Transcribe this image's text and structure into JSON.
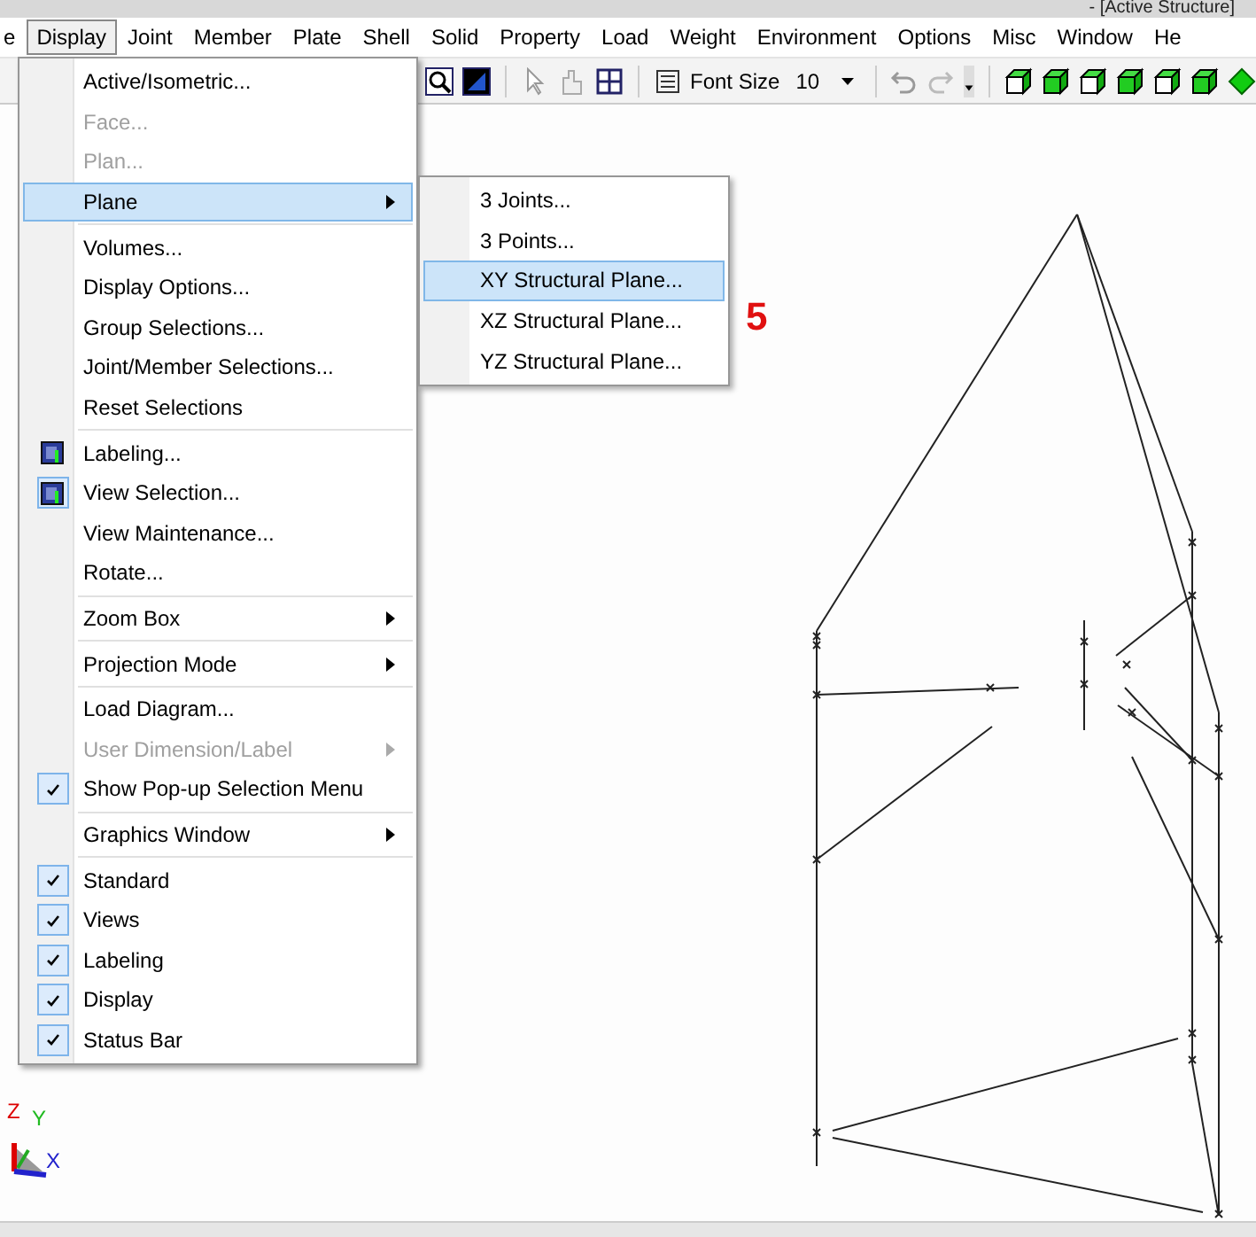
{
  "window": {
    "title": "- [Active Structure]"
  },
  "menubar": [
    {
      "label": "e",
      "selected": false
    },
    {
      "label": "Display",
      "selected": true
    },
    {
      "label": "Joint",
      "selected": false
    },
    {
      "label": "Member",
      "selected": false
    },
    {
      "label": "Plate",
      "selected": false
    },
    {
      "label": "Shell",
      "selected": false
    },
    {
      "label": "Solid",
      "selected": false
    },
    {
      "label": "Property",
      "selected": false
    },
    {
      "label": "Load",
      "selected": false
    },
    {
      "label": "Weight",
      "selected": false
    },
    {
      "label": "Environment",
      "selected": false
    },
    {
      "label": "Options",
      "selected": false
    },
    {
      "label": "Misc",
      "selected": false
    },
    {
      "label": "Window",
      "selected": false
    },
    {
      "label": "He",
      "selected": false
    }
  ],
  "toolbar": {
    "font_size_label": "Font Size",
    "font_size_value": "10"
  },
  "menu": [
    {
      "kind": "item",
      "label": "Active/Isometric...",
      "disabled": false,
      "selected": false
    },
    {
      "kind": "item",
      "label": "Face...",
      "disabled": true,
      "selected": false
    },
    {
      "kind": "item",
      "label": "Plan...",
      "disabled": true,
      "selected": false
    },
    {
      "kind": "submenu",
      "label": "Plane",
      "disabled": false,
      "selected": true
    },
    {
      "kind": "separator"
    },
    {
      "kind": "item",
      "label": "Volumes...",
      "disabled": false,
      "selected": false
    },
    {
      "kind": "item",
      "label": "Display Options...",
      "disabled": false,
      "selected": false
    },
    {
      "kind": "item",
      "label": "Group Selections...",
      "disabled": false,
      "selected": false
    },
    {
      "kind": "item",
      "label": "Joint/Member Selections...",
      "disabled": false,
      "selected": false
    },
    {
      "kind": "item",
      "label": "Reset Selections",
      "disabled": false,
      "selected": false
    },
    {
      "kind": "separator"
    },
    {
      "kind": "tool",
      "label": "Labeling...",
      "disabled": false,
      "selected": false,
      "checked": false
    },
    {
      "kind": "tool",
      "label": "View Selection...",
      "disabled": false,
      "selected": false,
      "checked": true
    },
    {
      "kind": "item",
      "label": "View Maintenance...",
      "disabled": false,
      "selected": false
    },
    {
      "kind": "item",
      "label": "Rotate...",
      "disabled": false,
      "selected": false
    },
    {
      "kind": "separator"
    },
    {
      "kind": "submenu",
      "label": "Zoom Box",
      "disabled": false,
      "selected": false
    },
    {
      "kind": "separator"
    },
    {
      "kind": "submenu",
      "label": "Projection Mode",
      "disabled": false,
      "selected": false
    },
    {
      "kind": "separator"
    },
    {
      "kind": "item",
      "label": "Load Diagram...",
      "disabled": false,
      "selected": false
    },
    {
      "kind": "submenu",
      "label": "User Dimension/Label",
      "disabled": true,
      "selected": false
    },
    {
      "kind": "check",
      "label": "Show Pop-up Selection Menu",
      "disabled": false,
      "selected": false,
      "checked": true
    },
    {
      "kind": "separator"
    },
    {
      "kind": "submenu",
      "label": "Graphics Window",
      "disabled": false,
      "selected": false
    },
    {
      "kind": "separator"
    },
    {
      "kind": "check",
      "label": "Standard",
      "disabled": false,
      "selected": false,
      "checked": true
    },
    {
      "kind": "check",
      "label": "Views",
      "disabled": false,
      "selected": false,
      "checked": true
    },
    {
      "kind": "check",
      "label": "Labeling",
      "disabled": false,
      "selected": false,
      "checked": true
    },
    {
      "kind": "check",
      "label": "Display",
      "disabled": false,
      "selected": false,
      "checked": true
    },
    {
      "kind": "check",
      "label": "Status Bar",
      "disabled": false,
      "selected": false,
      "checked": true
    }
  ],
  "submenu": [
    {
      "label": "3 Joints...",
      "selected": false
    },
    {
      "label": "3 Points...",
      "selected": false
    },
    {
      "label": "XY Structural Plane...",
      "selected": true
    },
    {
      "label": "XZ Structural Plane...",
      "selected": false
    },
    {
      "label": "YZ Structural Plane...",
      "selected": false
    }
  ],
  "step_label": "5",
  "axes": {
    "z": "Z",
    "y": "Y",
    "x": "X"
  }
}
